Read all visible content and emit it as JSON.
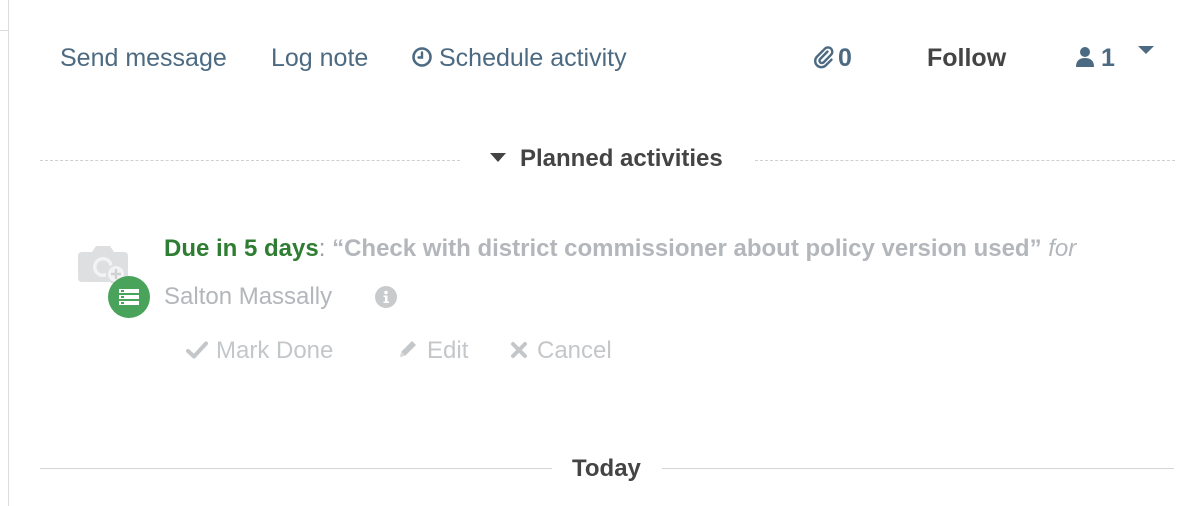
{
  "chatter_topbar": {
    "send_message_label": "Send message",
    "log_note_label": "Log note",
    "schedule_activity_label": "Schedule activity",
    "attachments_count": "0",
    "follow_label": "Follow",
    "followers_count": "1"
  },
  "planned_section": {
    "title": "Planned activities"
  },
  "activity": {
    "due_label": "Due in 5 days",
    "separator": ": ",
    "summary": "“Check with district commissioner about policy version used”",
    "for_label": " for",
    "assignee": "Salton Massally",
    "actions": {
      "mark_done_label": "Mark Done",
      "edit_label": "Edit",
      "cancel_label": "Cancel"
    }
  },
  "date_separator": {
    "label": "Today"
  },
  "colors": {
    "link": "#4c6a82",
    "due_green": "#2e7d32",
    "badge_green": "#4aa35b",
    "muted": "#b3b6ba",
    "heading": "#444444"
  },
  "icons": {
    "schedule": "clock-icon",
    "attachments": "paperclip-icon",
    "followers": "user-icon",
    "activity_type": "activity-list-icon",
    "info": "info-icon",
    "mark_done": "check-icon",
    "edit": "pencil-icon",
    "cancel": "times-icon"
  }
}
